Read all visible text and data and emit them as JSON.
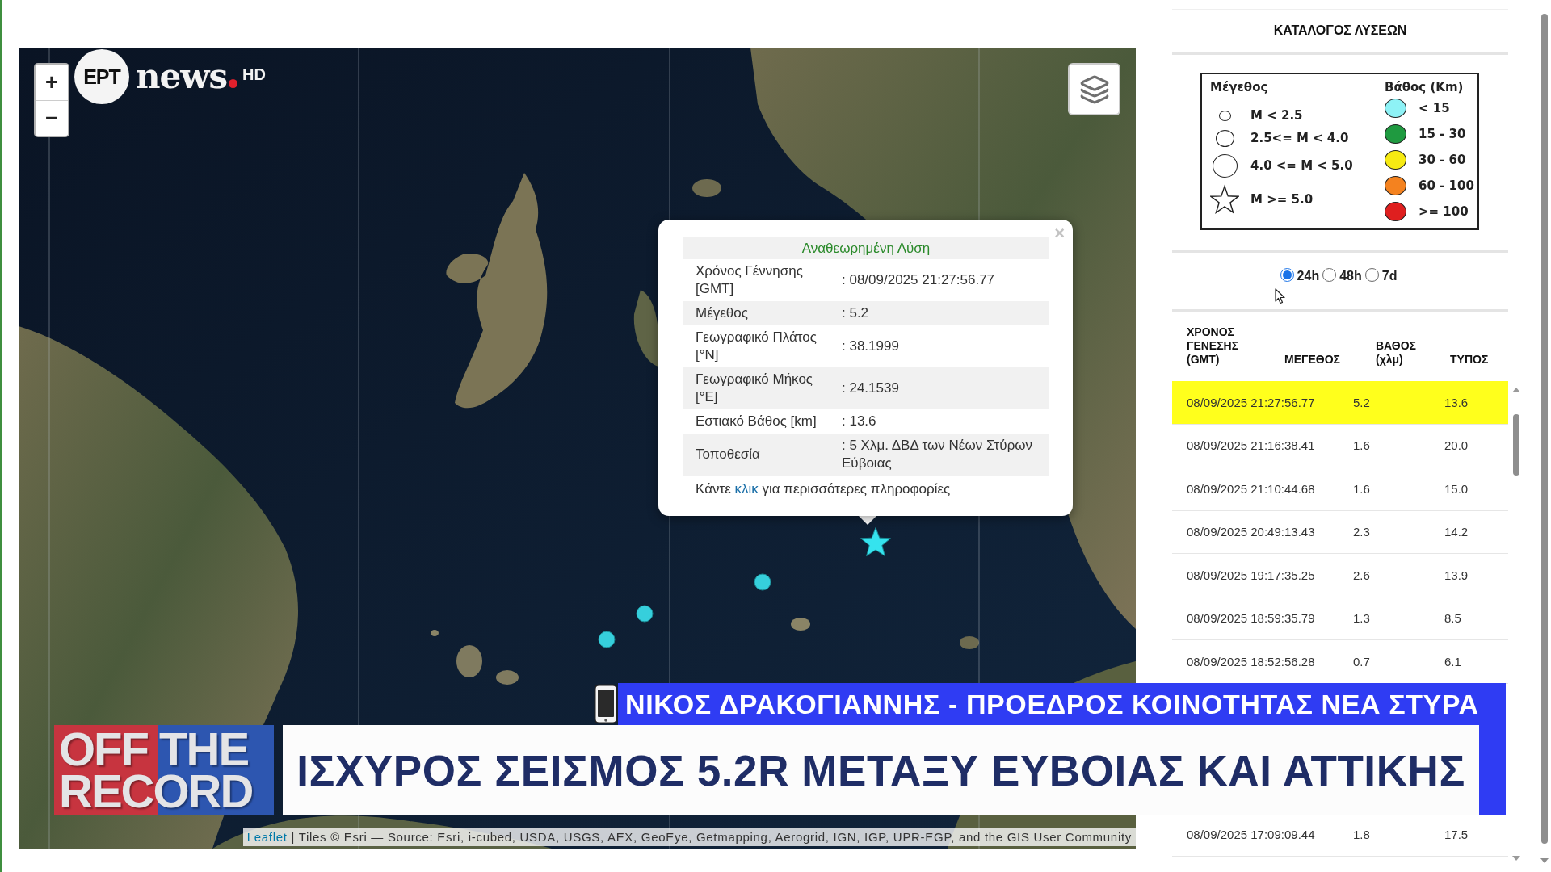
{
  "channel_logo": {
    "mark": "EPT",
    "wordmark": "news",
    "quality": "HD"
  },
  "map": {
    "zoom_in": "+",
    "zoom_out": "−",
    "markers": [
      {
        "kind": "star"
      },
      {
        "kind": "circle"
      },
      {
        "kind": "circle"
      },
      {
        "kind": "circle"
      }
    ],
    "popup": {
      "close": "×",
      "title": "Αναθεωρημένη Λύση",
      "rows": [
        {
          "label": "Χρόνος Γέννησης [GMT]",
          "value": ": 08/09/2025 21:27:56.77"
        },
        {
          "label": "Μέγεθος",
          "value": ": 5.2"
        },
        {
          "label": "Γεωγραφικό Πλάτος [°N]",
          "value": ": 38.1999"
        },
        {
          "label": "Γεωγραφικό Μήκος [°E]",
          "value": ": 24.1539"
        },
        {
          "label": "Εστιακό Βάθος [km]",
          "value": ": 13.6"
        },
        {
          "label": "Τοποθεσία",
          "value": ": 5 Χλμ. ΔΒΔ των Νέων Στύρων Εύβοιας"
        }
      ],
      "footer": {
        "before": "Κάντε",
        "link": "κλικ",
        "after": "για περισσότερες πληροφορίες"
      }
    },
    "attribution": {
      "link": "Leaflet",
      "text": "| Tiles © Esri — Source: Esri, i-cubed, USDA, USGS, AEX, GeoEye, Getmapping, Aerogrid, IGN, IGP, UPR-EGP, and the GIS User Community"
    }
  },
  "side_panel": {
    "title": "ΚΑΤΑΛΟΓΟΣ ΛΥΣΕΩΝ",
    "legend": {
      "magnitude_title": "Μέγεθος",
      "magnitude_items": [
        {
          "kind": "small_circle",
          "label": "M < 2.5"
        },
        {
          "kind": "medium_circle",
          "label": "2.5<= M < 4.0"
        },
        {
          "kind": "large_circle",
          "label": "4.0 <= M < 5.0"
        },
        {
          "kind": "star",
          "label": "M >= 5.0"
        }
      ],
      "depth_title": "Βάθος (Km)",
      "depth_items": [
        {
          "label": "< 15",
          "color": "#8ef2f6"
        },
        {
          "label": "15 - 30",
          "color": "#1f9a40"
        },
        {
          "label": "30 - 60",
          "color": "#f6ea12"
        },
        {
          "label": "60 - 100",
          "color": "#f4821f"
        },
        {
          "label": ">= 100",
          "color": "#df1f1f"
        }
      ]
    },
    "periods": [
      {
        "label": "24h",
        "selected": true
      },
      {
        "label": "48h",
        "selected": false
      },
      {
        "label": "7d",
        "selected": false
      }
    ],
    "table": {
      "columns": [
        "ΧΡΟΝΟΣ ΓΕΝΕΣΗΣ (GMT)",
        "ΜΕΓΕΘΟΣ",
        "ΒΑΘΟΣ (χλμ)",
        "ΤΥΠΟΣ"
      ],
      "rows": [
        {
          "cells": [
            "08/09/2025 21:27:56.77",
            "5.2",
            "13.6"
          ],
          "selected": true
        },
        {
          "cells": [
            "08/09/2025 21:16:38.41",
            "1.6",
            "20.0"
          ],
          "selected": false
        },
        {
          "cells": [
            "08/09/2025 21:10:44.68",
            "1.6",
            "15.0"
          ],
          "selected": false
        },
        {
          "cells": [
            "08/09/2025 20:49:13.43",
            "2.3",
            "14.2"
          ],
          "selected": false
        },
        {
          "cells": [
            "08/09/2025 19:17:35.25",
            "2.6",
            "13.9"
          ],
          "selected": false
        },
        {
          "cells": [
            "08/09/2025 18:59:35.79",
            "1.3",
            "8.5"
          ],
          "selected": false
        },
        {
          "cells": [
            "08/09/2025 18:52:56.28",
            "0.7",
            "6.1"
          ],
          "selected": false
        },
        {
          "cells": [
            "08/09/2025 17:09:09.44",
            "1.8",
            "17.5"
          ],
          "selected": false
        }
      ]
    }
  },
  "lower_third": {
    "show_logo": [
      "OFF THE",
      "RECORD"
    ],
    "caption": "ΝΙΚΟΣ ΔΡΑΚΟΓΙΑΝΝΗΣ - ΠΡΟΕΔΡΟΣ ΚΟΙΝΟΤΗΤΑΣ ΝΕΑ ΣΤΥΡΑ",
    "headline": "ΙΣΧΥΡΟΣ ΣΕΙΣΜΟΣ 5.2R ΜΕΤΑΞΥ ΕΥΒΟΙΑΣ ΚΑΙ ΑΤΤΙΚΗΣ"
  }
}
